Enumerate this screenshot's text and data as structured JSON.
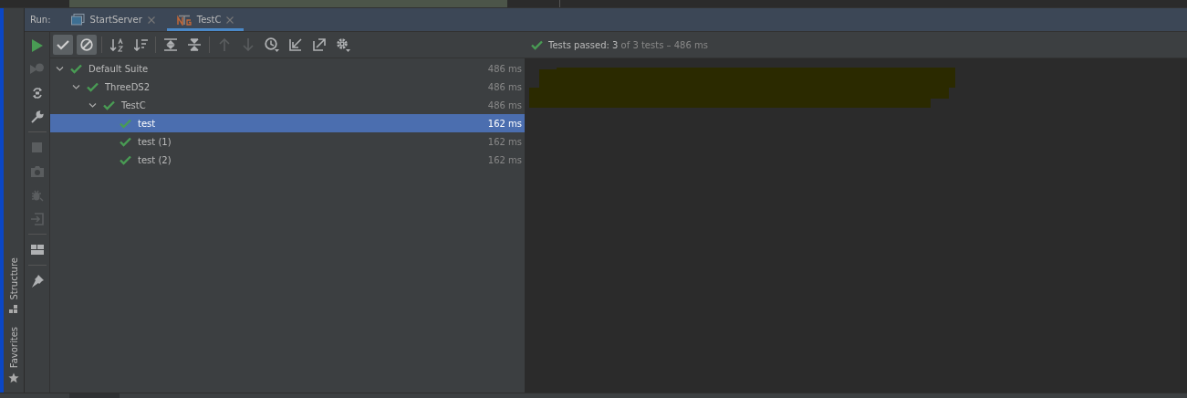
{
  "side_tabs": [
    "Structure",
    "Favorites"
  ],
  "run_label": "Run:",
  "tabs": [
    {
      "label": "StartServer",
      "selected": false,
      "kind": "app"
    },
    {
      "label": "TestC",
      "selected": true,
      "kind": "testng"
    }
  ],
  "left_toolbar": [
    {
      "kind": "run",
      "disabled": false
    },
    {
      "kind": "rerun-failed",
      "disabled": true
    },
    {
      "kind": "toggle-auto",
      "disabled": false
    },
    {
      "kind": "wrench",
      "disabled": false
    },
    {
      "kind": "sep"
    },
    {
      "kind": "stop",
      "disabled": true
    },
    {
      "kind": "camera",
      "disabled": true
    },
    {
      "kind": "bug",
      "disabled": true
    },
    {
      "kind": "exit",
      "disabled": true
    },
    {
      "kind": "sep"
    },
    {
      "kind": "layout",
      "disabled": false
    },
    {
      "kind": "sep"
    },
    {
      "kind": "pin",
      "disabled": false
    }
  ],
  "top_toolbar": [
    {
      "kind": "check",
      "on": true
    },
    {
      "kind": "ignored",
      "on": true
    },
    {
      "kind": "sep"
    },
    {
      "kind": "sort-alpha",
      "on": false
    },
    {
      "kind": "sort-duration",
      "on": false
    },
    {
      "kind": "sep"
    },
    {
      "kind": "expand",
      "on": false
    },
    {
      "kind": "collapse",
      "on": false
    },
    {
      "kind": "sep"
    },
    {
      "kind": "up",
      "disabled": true
    },
    {
      "kind": "down",
      "disabled": true
    },
    {
      "kind": "history",
      "disabled": false
    },
    {
      "kind": "import",
      "disabled": false
    },
    {
      "kind": "export",
      "disabled": false
    },
    {
      "kind": "settings",
      "disabled": false
    }
  ],
  "status": "**Tests passed: 3** of 3 tests – 486 ms",
  "tree": [
    {
      "label": "Default Suite",
      "time": "486 ms",
      "expanded": true,
      "selected": false,
      "children": [
        {
          "label": "ThreeDS2",
          "time": "486 ms",
          "expanded": true,
          "selected": false,
          "children": [
            {
              "label": "TestC",
              "time": "486 ms",
              "expanded": true,
              "selected": false,
              "children": [
                {
                  "label": "test",
                  "time": "162 ms",
                  "selected": true
                },
                {
                  "label": "test (1)",
                  "time": "162 ms",
                  "selected": false
                },
                {
                  "label": "test (2)",
                  "time": "162 ms",
                  "selected": false
                }
              ]
            }
          ]
        }
      ]
    }
  ]
}
